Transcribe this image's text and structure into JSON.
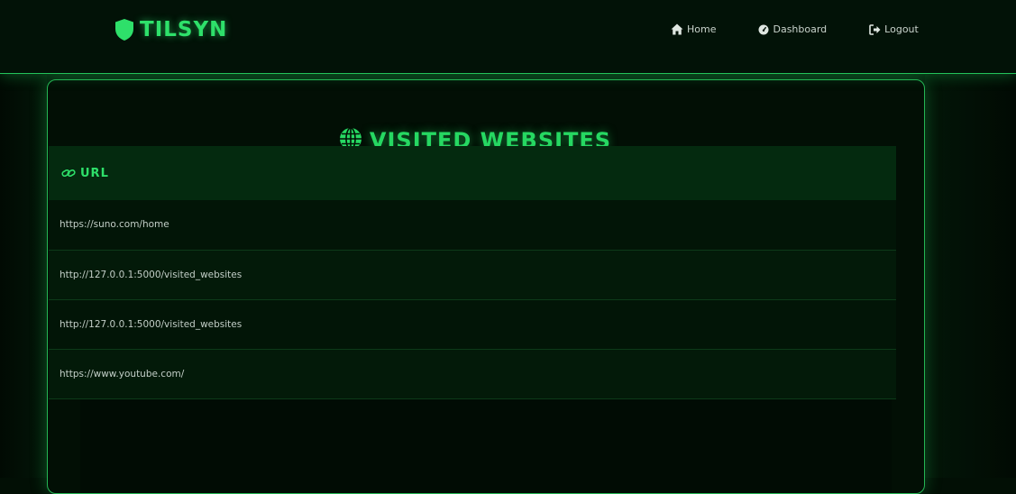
{
  "navbar": {
    "brand": "TILSYN",
    "links": [
      {
        "label": "Home",
        "icon": "home-icon"
      },
      {
        "label": "Dashboard",
        "icon": "gauge-icon"
      },
      {
        "label": "Logout",
        "icon": "logout-icon"
      }
    ]
  },
  "page": {
    "title": "VISITED WEBSITES",
    "title_icon": "globe-icon"
  },
  "table": {
    "header": {
      "label": "URL",
      "icon": "link-icon"
    },
    "rows": [
      "https://suno.com/home",
      "http://127.0.0.1:5000/visited_websites",
      "http://127.0.0.1:5000/visited_websites",
      "https://www.youtube.com/"
    ]
  },
  "colors": {
    "accent": "#26d862",
    "background": "#020f05",
    "header_row": "#042a0f"
  }
}
